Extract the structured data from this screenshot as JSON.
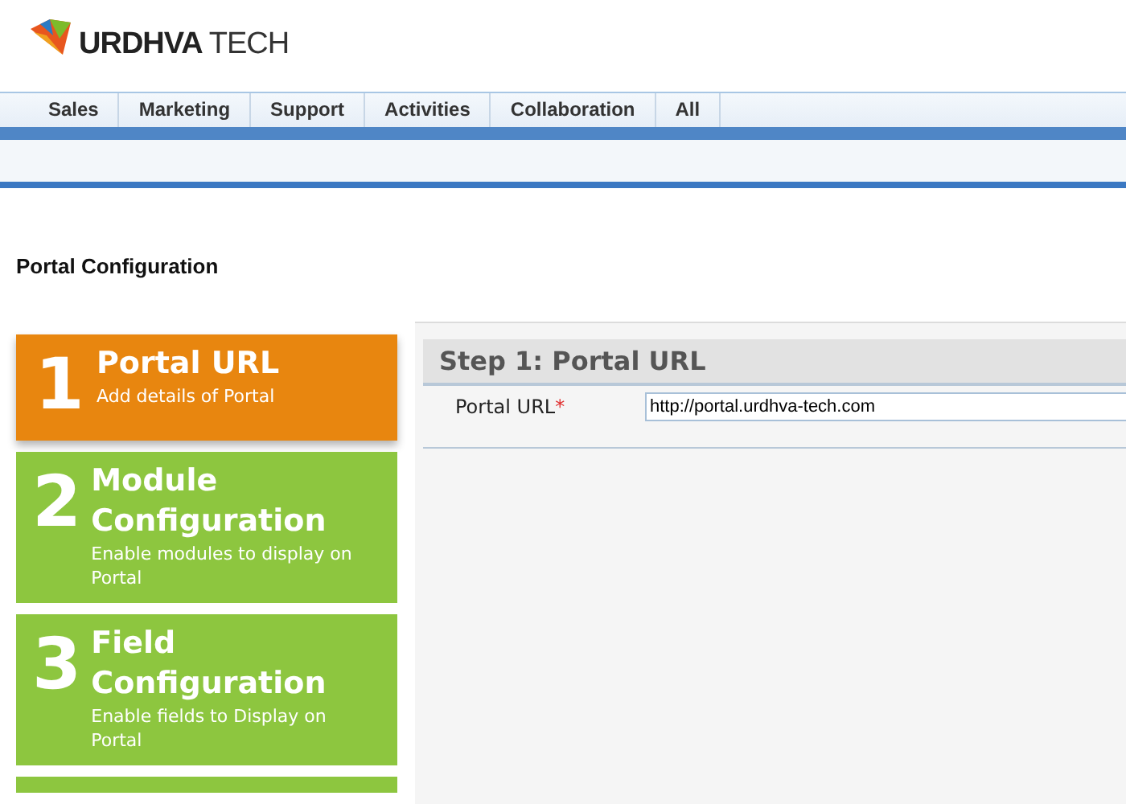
{
  "logo": {
    "brand": "URDHVA",
    "suffix": "TECH"
  },
  "nav": [
    {
      "label": "Sales",
      "selected": false
    },
    {
      "label": "Marketing",
      "selected": false
    },
    {
      "label": "Support",
      "selected": false
    },
    {
      "label": "Activities",
      "selected": false
    },
    {
      "label": "Collaboration",
      "selected": false
    },
    {
      "label": "All",
      "selected": false
    }
  ],
  "page_title": "Portal Configuration",
  "steps": [
    {
      "number": "1",
      "title": "Portal URL",
      "description": "Add details of Portal",
      "selected": true
    },
    {
      "number": "2",
      "title": "Module Configuration",
      "description": "Enable modules to display on Portal",
      "selected": false
    },
    {
      "number": "3",
      "title": "Field Configuration",
      "description": "Enable fields to Display on Portal",
      "selected": false
    }
  ],
  "panel": {
    "heading": "Step 1: Portal URL",
    "fields": [
      {
        "label": "Portal URL",
        "required_mark": "*",
        "value": "http://portal.urdhva-tech.com"
      }
    ]
  }
}
